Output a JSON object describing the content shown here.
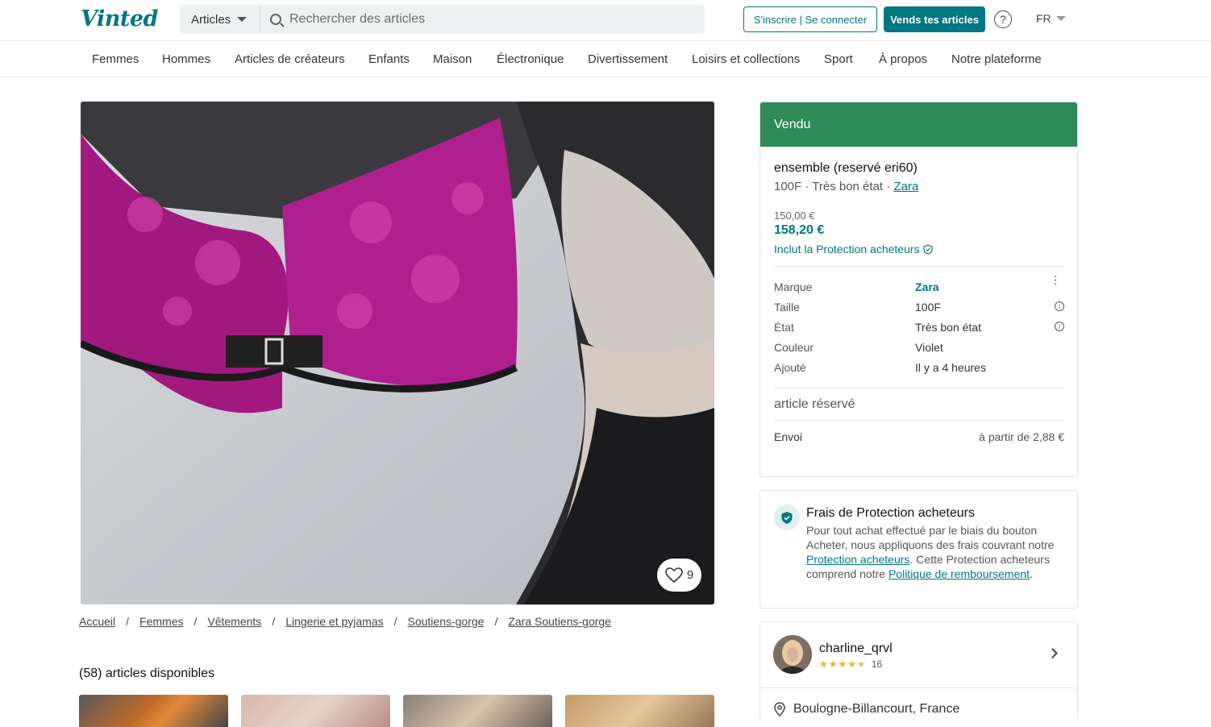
{
  "header": {
    "logo": "Vinted",
    "search_category": "Articles",
    "search_placeholder": "Rechercher des articles",
    "login_label": "S'inscrire | Se connecter",
    "sell_label": "Vends tes articles",
    "help_label": "?",
    "language": "FR"
  },
  "nav": {
    "items": [
      "Femmes",
      "Hommes",
      "Articles de créateurs",
      "Enfants",
      "Maison",
      "Électronique",
      "Divertissement",
      "Loisirs et collections",
      "Sport",
      "À propos",
      "Notre plateforme"
    ]
  },
  "photo": {
    "favorites_count": "9"
  },
  "breadcrumb": [
    "Accueil",
    "Femmes",
    "Vêtements",
    "Lingerie et pyjamas",
    "Soutiens-gorge",
    "Zara Soutiens-gorge"
  ],
  "available_title": "(58) articles disponibles",
  "item": {
    "status": "Vendu",
    "title": "ensemble (reservé eri60)",
    "size_condition": "100F · Très bon état · ",
    "brand_link": "Zara",
    "old_price": "150,00 €",
    "price": "158,20 €",
    "protection_label": "Inclut la Protection acheteurs",
    "details": [
      {
        "key": "Marque",
        "value": "Zara"
      },
      {
        "key": "Taille",
        "value": "100F"
      },
      {
        "key": "État",
        "value": "Très bon état"
      },
      {
        "key": "Couleur",
        "value": "Violet"
      },
      {
        "key": "Ajouté",
        "value": "Il y a 4 heures"
      }
    ],
    "reserved_label": "article réservé",
    "shipping_label": "Envoi",
    "shipping_value": "à partir de 2,88 €"
  },
  "protection_box": {
    "title": "Frais de Protection acheteurs",
    "desc_part1": "Pour tout achat effectué par le biais du bouton Acheter, nous appliquons des frais couvrant notre ",
    "link1": "Protection acheteurs",
    "desc_part2": ". Cette Protection acheteurs comprend notre ",
    "link2": "Politique de remboursement",
    "desc_part3": "."
  },
  "seller": {
    "name": "charline_qrvl",
    "rating": 4.5,
    "reviews": "16",
    "location": "Boulogne-Billancourt, France"
  },
  "colors": {
    "accent": "#007782",
    "sold_banner": "#2e8b57",
    "star": "#f3b01b"
  }
}
